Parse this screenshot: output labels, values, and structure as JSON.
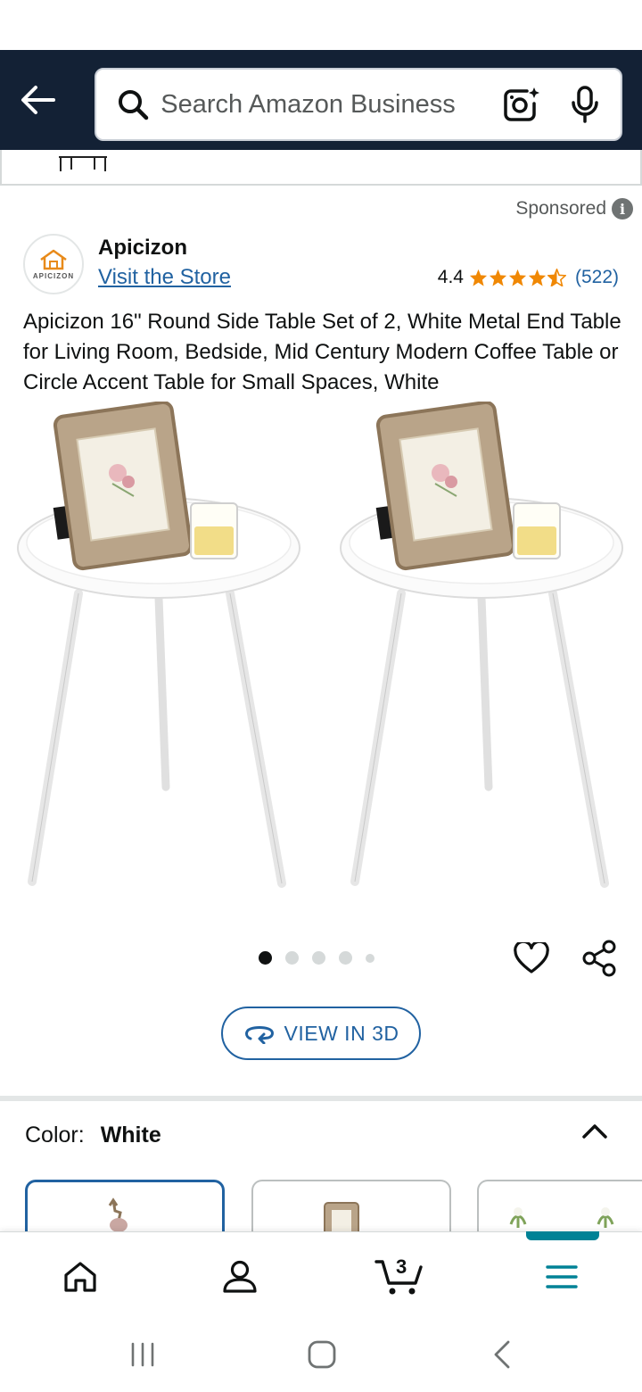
{
  "search": {
    "placeholder": "Search Amazon Business"
  },
  "ad": {
    "sponsored_label": "Sponsored",
    "brand_name": "Apicizon",
    "brand_logo_text": "APICIZON",
    "visit_store_label": "Visit the Store",
    "rating_value": "4.4",
    "rating_stars": 4.4,
    "rating_count": "(522)"
  },
  "product": {
    "title": "Apicizon 16\" Round Side Table Set of 2, White Metal End Table for Living Room, Bedside, Mid Century Modern Coffee Table or Circle Accent Table for Small Spaces, White",
    "image_count": 5,
    "active_image_index": 0,
    "view_3d_label": "VIEW IN 3D"
  },
  "variation": {
    "label": "Color:",
    "selected_value": "White"
  },
  "cart": {
    "count": "3"
  },
  "colors": {
    "header_bg": "#132135",
    "link": "#2162a1",
    "star": "#f08804",
    "accent_teal": "#008296"
  },
  "icons": {
    "back": "back-arrow-icon",
    "search": "search-icon",
    "lens": "camera-lens-icon",
    "mic": "microphone-icon",
    "heart": "heart-icon",
    "share": "share-icon",
    "rotate": "rotate-3d-icon",
    "collapse": "chevron-up-icon",
    "home": "home-icon",
    "account": "account-icon",
    "cart": "cart-icon",
    "menu": "menu-icon"
  }
}
